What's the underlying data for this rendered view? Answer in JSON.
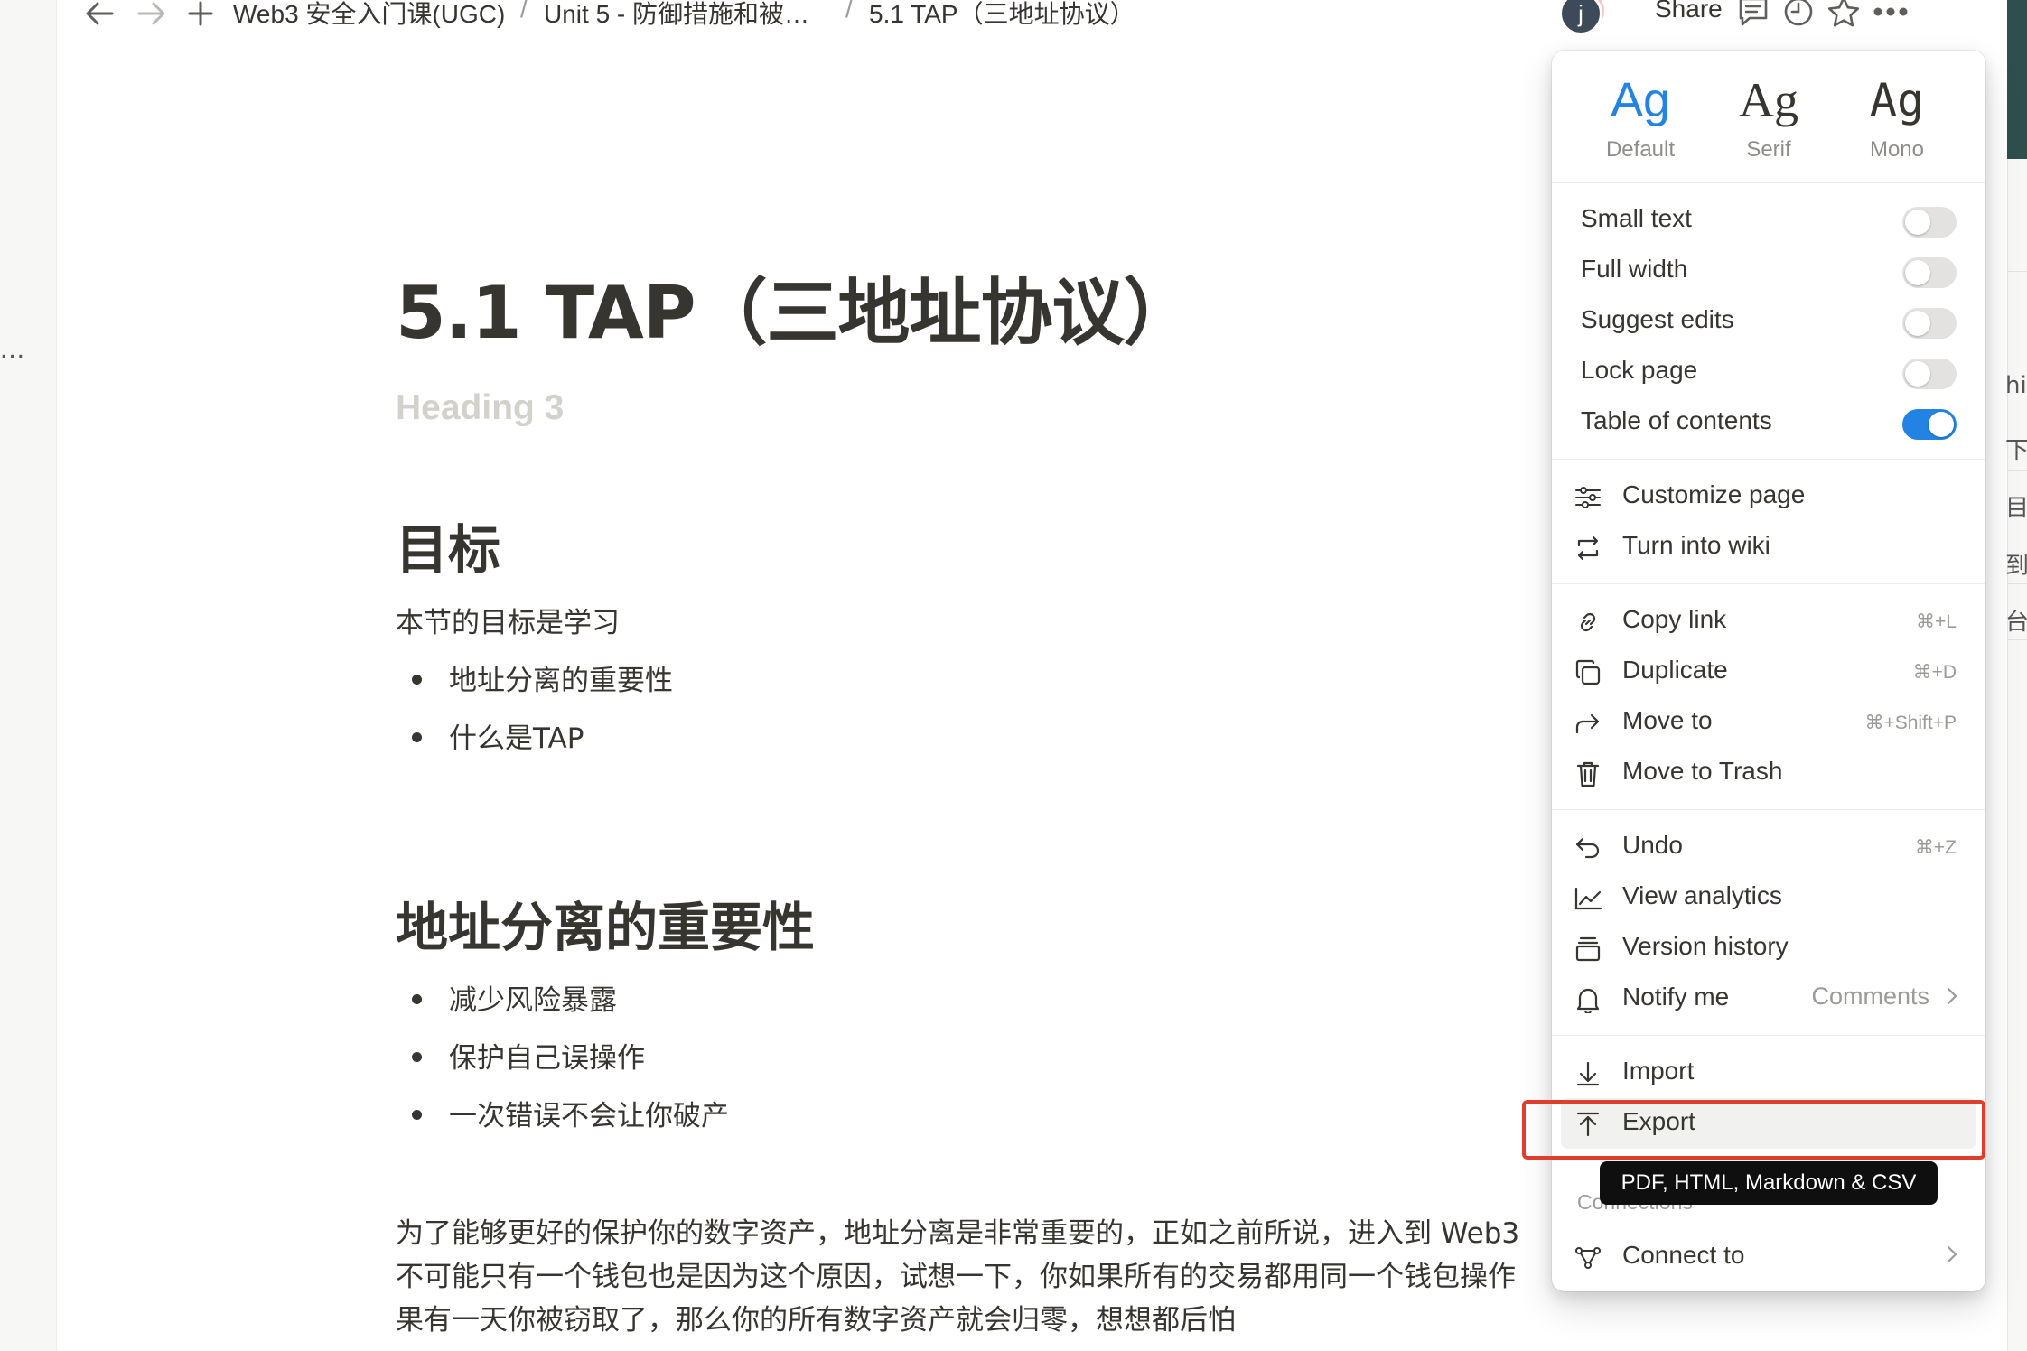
{
  "breadcrumb": {
    "items": [
      "Web3 安全入门课(UGC)",
      "Unit 5 - 防御措施和被…",
      "5.1 TAP（三地址协议）"
    ],
    "separator": "/"
  },
  "topbar": {
    "share_label": "Share",
    "avatar_1": "j",
    "avatar_2": "j"
  },
  "page": {
    "title": "5.1 TAP（三地址协议）",
    "placeholder": "Heading 3",
    "sections": [
      {
        "heading": "目标",
        "intro": "本节的目标是学习",
        "bullets": [
          "地址分离的重要性",
          "什么是TAP"
        ]
      },
      {
        "heading": "地址分离的重要性",
        "bullets": [
          "减少风险暴露",
          "保护自己误操作",
          "一次错误不会让你破产"
        ]
      }
    ],
    "body_lines": [
      "为了能够更好的保护你的数字资产，地址分离是非常重要的，正如之前所说，进入到 Web3",
      "不可能只有一个钱包也是因为这个原因，试想一下，你如果所有的交易都用同一个钱包操作",
      "果有一天你被窃取了，那么你的所有数字资产就会归零，想想都后怕"
    ]
  },
  "left_strip": {
    "dots": "..."
  },
  "right_strip": {
    "chars": [
      "hi",
      "下",
      "目",
      "到",
      "台"
    ]
  },
  "menu": {
    "fonts": [
      {
        "sample": "Ag",
        "label": "Default",
        "selected": true
      },
      {
        "sample": "Ag",
        "label": "Serif",
        "selected": false
      },
      {
        "sample": "Ag",
        "label": "Mono",
        "selected": false
      }
    ],
    "toggles": [
      {
        "label": "Small text",
        "on": false
      },
      {
        "label": "Full width",
        "on": false
      },
      {
        "label": "Suggest edits",
        "on": false
      },
      {
        "label": "Lock page",
        "on": false
      },
      {
        "label": "Table of contents",
        "on": true
      }
    ],
    "customize": {
      "label": "Customize page",
      "icon": "sliders-icon"
    },
    "turn_into_wiki": {
      "label": "Turn into wiki",
      "icon": "convert-icon"
    },
    "copy_link": {
      "label": "Copy link",
      "shortcut": "⌘+L",
      "icon": "link-icon"
    },
    "duplicate": {
      "label": "Duplicate",
      "shortcut": "⌘+D",
      "icon": "duplicate-icon"
    },
    "move_to": {
      "label": "Move to",
      "shortcut": "⌘+Shift+P",
      "icon": "arrow-turn-icon"
    },
    "trash": {
      "label": "Move to Trash",
      "icon": "trash-icon"
    },
    "undo": {
      "label": "Undo",
      "shortcut": "⌘+Z",
      "icon": "undo-icon"
    },
    "analytics": {
      "label": "View analytics",
      "icon": "chart-icon"
    },
    "version": {
      "label": "Version history",
      "icon": "history-icon"
    },
    "notify": {
      "label": "Notify me",
      "value": "Comments",
      "icon": "bell-icon"
    },
    "import": {
      "label": "Import",
      "icon": "download-icon"
    },
    "export": {
      "label": "Export",
      "icon": "upload-icon"
    },
    "connections_header": "Connections",
    "connect_to": {
      "label": "Connect to",
      "icon": "nodes-icon"
    }
  },
  "tooltip": {
    "text": "PDF, HTML, Markdown & CSV"
  },
  "colors": {
    "accent": "#2383e2",
    "highlight": "#e03e2d",
    "text": "#37352f"
  }
}
